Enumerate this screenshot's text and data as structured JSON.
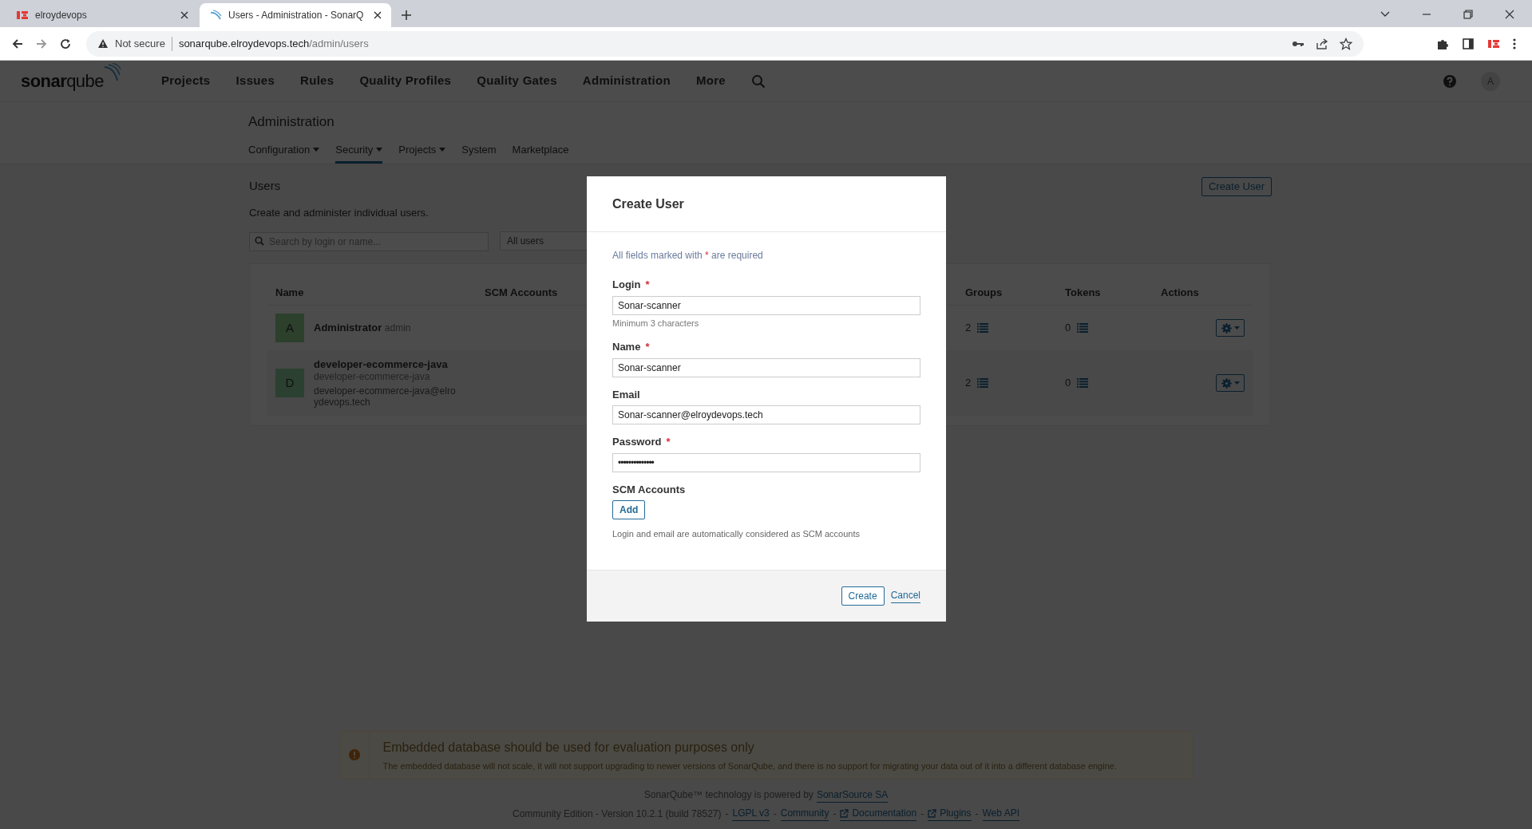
{
  "browser": {
    "tabs": [
      {
        "title": "elroydevops",
        "kind": "brand",
        "selected": false
      },
      {
        "title": "Users - Administration - SonarQ",
        "kind": "sonar",
        "selected": true
      }
    ],
    "security_label": "Not secure",
    "url_host": "sonarqube.elroydevops.tech",
    "url_path": "/admin/users"
  },
  "nav": {
    "logo": "**sonar**qube",
    "items": [
      "Projects",
      "Issues",
      "Rules",
      "Quality Profiles",
      "Quality Gates",
      "Administration",
      "More"
    ],
    "avatar": "A"
  },
  "admin": {
    "title": "Administration",
    "menu": [
      {
        "label": "Configuration",
        "dropdown": true,
        "selected": false
      },
      {
        "label": "Security",
        "dropdown": true,
        "selected": true
      },
      {
        "label": "Projects",
        "dropdown": true,
        "selected": false
      },
      {
        "label": "System",
        "dropdown": false,
        "selected": false
      },
      {
        "label": "Marketplace",
        "dropdown": false,
        "selected": false
      }
    ]
  },
  "users": {
    "title": "Users",
    "description": "Create and administer individual users.",
    "create_button": "Create User",
    "search": {
      "placeholder": "Search by login or name..."
    },
    "filter": "All users",
    "columns": [
      "Name",
      "SCM Accounts",
      "Groups",
      "Tokens",
      "Actions"
    ],
    "rows": [
      {
        "avatar": "A",
        "name": "Administrator",
        "login": "admin",
        "groups": "2",
        "tokens": "0"
      },
      {
        "avatar": "D",
        "name": "developer-ecommerce-java",
        "login": "developer-ecommerce-java",
        "email": "developer-ecommerce-java@elroydevops.tech",
        "groups": "2",
        "tokens": "0"
      }
    ]
  },
  "dialog": {
    "title": "Create User",
    "note": {
      "before": "All fields marked with",
      "mark": "*",
      "after": "are required"
    },
    "fields": [
      {
        "label": "Login",
        "required": true,
        "value": "Sonar-scanner",
        "hint": "Minimum 3 characters",
        "kind": "text"
      },
      {
        "label": "Name",
        "required": true,
        "value": "Sonar-scanner",
        "kind": "text"
      },
      {
        "label": "Email",
        "required": false,
        "value": "Sonar-scanner@elroydevops.tech",
        "kind": "text"
      },
      {
        "label": "Password",
        "required": true,
        "value": "••••••••••••••",
        "kind": "password"
      }
    ],
    "scm": {
      "label": "SCM Accounts",
      "button": "Add",
      "help": "Login and email are automatically considered as SCM accounts"
    },
    "create_button": "Create",
    "cancel_link": "Cancel"
  },
  "warning": {
    "title": "Embedded database should be used for evaluation purposes only",
    "text": "The embedded database will not scale, it will not support upgrading to newer versions of SonarQube, and there is no support for migrating your data out of it into a different database engine."
  },
  "footer": {
    "powered_text": "SonarQube™ technology is powered by",
    "powered_link": "SonarSource SA",
    "edition": "Community Edition - Version 10.2.1 (build 78527)",
    "separator": "-",
    "links": [
      {
        "label": "LGPL v3",
        "external": false
      },
      {
        "label": "Community",
        "external": false
      },
      {
        "label": "Documentation",
        "external": true
      },
      {
        "label": "Plugins",
        "external": true
      },
      {
        "label": "Web API",
        "external": false
      }
    ]
  }
}
